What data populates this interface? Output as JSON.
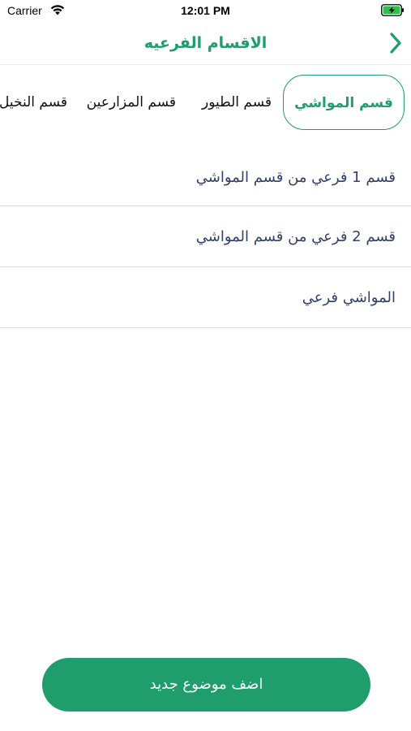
{
  "status_bar": {
    "carrier": "Carrier",
    "time": "12:01 PM"
  },
  "nav": {
    "title": "الاقسام الفرعيه",
    "back_icon": "chevron-right-icon"
  },
  "tabs": [
    {
      "label": "قسم المواشي",
      "selected": true
    },
    {
      "label": "قسم الطيور",
      "selected": false
    },
    {
      "label": "قسم المزارعين",
      "selected": false
    },
    {
      "label": "قسم النخيل",
      "selected": false
    }
  ],
  "subcategories": [
    {
      "label": "قسم 1 فرعي من قسم المواشي"
    },
    {
      "label": "قسم 2 فرعي من قسم المواشي"
    },
    {
      "label": "المواشي فرعي"
    }
  ],
  "add_button": {
    "label": "اضف موضوع جديد"
  },
  "colors": {
    "accent": "#1f9d6c",
    "list_text": "#33406a",
    "divider": "#d9d9d9"
  }
}
